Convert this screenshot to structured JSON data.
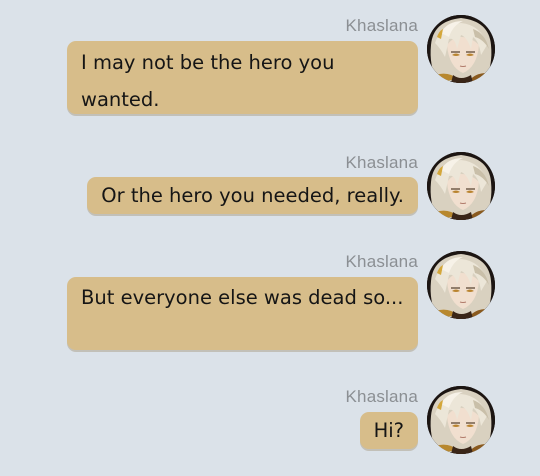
{
  "messages": [
    {
      "sender": "Khaslana",
      "text": "I may not be the hero you wanted.",
      "avatar_icon": "character-portrait-icon"
    },
    {
      "sender": "Khaslana",
      "text": "Or the hero you needed, really.",
      "avatar_icon": "character-portrait-icon"
    },
    {
      "sender": "Khaslana",
      "text": "But everyone else was dead so...",
      "avatar_icon": "character-portrait-icon"
    },
    {
      "sender": "Khaslana",
      "text": "Hi?",
      "avatar_icon": "character-portrait-icon"
    }
  ],
  "colors": {
    "background": "#dbe2e9",
    "bubble": "#d7bd8a",
    "sender_name": "#8b8f93",
    "text": "#151515"
  }
}
